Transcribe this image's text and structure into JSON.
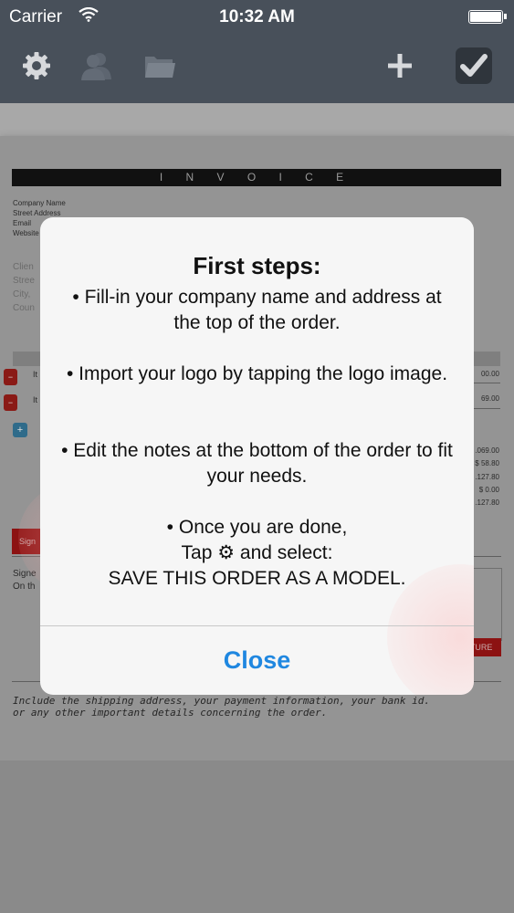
{
  "status_bar": {
    "carrier": "Carrier",
    "time": "10:32 AM",
    "wifi_icon": "wifi-icon",
    "battery_icon": "battery-icon"
  },
  "toolbar": {
    "settings_icon": "gear-icon",
    "contacts_icon": "contacts-icon",
    "folder_icon": "folder-icon",
    "add_icon": "plus-icon",
    "done_icon": "checkmark-icon"
  },
  "invoice": {
    "title": "I N V O I C E",
    "company_lines": [
      "Company Name",
      "Street Address",
      "Email",
      "Website"
    ],
    "client_lines": [
      "Clien",
      "Stree",
      "City,",
      "Coun"
    ],
    "item_rows": [
      {
        "label": "It",
        "amount": "00.00"
      },
      {
        "label": "It",
        "amount": "69.00"
      }
    ],
    "totals": [
      ".069.00",
      "$ 58.80",
      ".127.80",
      "$ 0.00",
      ".127.80"
    ],
    "sign_button_label": "Sign",
    "signed_lines": [
      "Signe",
      "On th"
    ],
    "signature_button_label": "ATURE",
    "notes_lines": [
      "Include the shipping address, your payment information, your bank id.",
      "or any other important details concerning the order."
    ]
  },
  "modal": {
    "title": "First steps:",
    "step1": "• Fill-in your company name and address at the top of the order.",
    "step2": "• Import your logo by tapping the logo image.",
    "step3": "• Edit the notes at the bottom of the order to fit your needs.",
    "step4_line1": "• Once you are done,",
    "step4_line2": "Tap ⚙ and select:",
    "step4_line3": "SAVE THIS ORDER AS A MODEL.",
    "close_label": "Close"
  },
  "colors": {
    "toolbar_bg": "#48505a",
    "close_text": "#1f87e0",
    "delete_red": "#8a1a16"
  }
}
